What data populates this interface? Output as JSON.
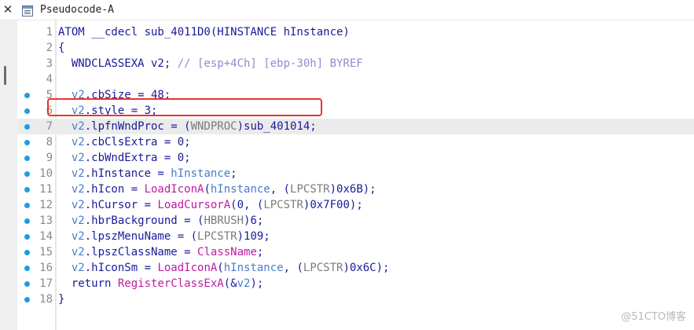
{
  "tab": {
    "close_glyph": "✕",
    "title": "Pseudocode-A",
    "icon": "pseudocode-window-icon"
  },
  "colors": {
    "breakpoint": "#1e9be9",
    "highlight_box": "#e6362d",
    "current_line": "#ebebeb",
    "keyword": "#1a1a99",
    "variable": "#4a7acb",
    "global": "#c01aa3",
    "comment": "#8d8dcc",
    "type_cast": "#7b7b7b"
  },
  "code_lines": [
    {
      "num": "1",
      "bp": false,
      "current": false,
      "tokens": [
        {
          "t": "ATOM __cdecl sub_4011D0(HINSTANCE hInstance)",
          "c": "n"
        }
      ]
    },
    {
      "num": "2",
      "bp": false,
      "current": false,
      "tokens": [
        {
          "t": "{",
          "c": "n"
        }
      ]
    },
    {
      "num": "3",
      "bp": false,
      "current": false,
      "tokens": [
        {
          "t": "  WNDCLASSEXA v2; ",
          "c": "n"
        },
        {
          "t": "// [esp+4Ch] [ebp-30h] BYREF",
          "c": "c"
        }
      ]
    },
    {
      "num": "4",
      "bp": false,
      "current": false,
      "tokens": []
    },
    {
      "num": "5",
      "bp": true,
      "current": false,
      "tokens": [
        {
          "t": "  ",
          "c": "n"
        },
        {
          "t": "v2",
          "c": "v"
        },
        {
          "t": ".cbSize = 48;",
          "c": "n"
        }
      ]
    },
    {
      "num": "6",
      "bp": true,
      "current": false,
      "tokens": [
        {
          "t": "  ",
          "c": "n"
        },
        {
          "t": "v2",
          "c": "v"
        },
        {
          "t": ".style = 3;",
          "c": "n"
        }
      ]
    },
    {
      "num": "7",
      "bp": true,
      "current": true,
      "tokens": [
        {
          "t": "  ",
          "c": "n"
        },
        {
          "t": "v2",
          "c": "v"
        },
        {
          "t": ".lpfnWndProc = (",
          "c": "n"
        },
        {
          "t": "WNDPROC",
          "c": "t"
        },
        {
          "t": ")sub_401014;",
          "c": "n"
        }
      ]
    },
    {
      "num": "8",
      "bp": true,
      "current": false,
      "tokens": [
        {
          "t": "  ",
          "c": "n"
        },
        {
          "t": "v2",
          "c": "v"
        },
        {
          "t": ".cbClsExtra = 0;",
          "c": "n"
        }
      ]
    },
    {
      "num": "9",
      "bp": true,
      "current": false,
      "tokens": [
        {
          "t": "  ",
          "c": "n"
        },
        {
          "t": "v2",
          "c": "v"
        },
        {
          "t": ".cbWndExtra = 0;",
          "c": "n"
        }
      ]
    },
    {
      "num": "10",
      "bp": true,
      "current": false,
      "tokens": [
        {
          "t": "  ",
          "c": "n"
        },
        {
          "t": "v2",
          "c": "v"
        },
        {
          "t": ".hInstance = ",
          "c": "n"
        },
        {
          "t": "hInstance",
          "c": "v"
        },
        {
          "t": ";",
          "c": "n"
        }
      ]
    },
    {
      "num": "11",
      "bp": true,
      "current": false,
      "tokens": [
        {
          "t": "  ",
          "c": "n"
        },
        {
          "t": "v2",
          "c": "v"
        },
        {
          "t": ".hIcon = ",
          "c": "n"
        },
        {
          "t": "LoadIconA",
          "c": "g"
        },
        {
          "t": "(",
          "c": "n"
        },
        {
          "t": "hInstance",
          "c": "v"
        },
        {
          "t": ", (",
          "c": "n"
        },
        {
          "t": "LPCSTR",
          "c": "t"
        },
        {
          "t": ")0x6B);",
          "c": "n"
        }
      ]
    },
    {
      "num": "12",
      "bp": true,
      "current": false,
      "tokens": [
        {
          "t": "  ",
          "c": "n"
        },
        {
          "t": "v2",
          "c": "v"
        },
        {
          "t": ".hCursor = ",
          "c": "n"
        },
        {
          "t": "LoadCursorA",
          "c": "g"
        },
        {
          "t": "(0, (",
          "c": "n"
        },
        {
          "t": "LPCSTR",
          "c": "t"
        },
        {
          "t": ")0x7F00);",
          "c": "n"
        }
      ]
    },
    {
      "num": "13",
      "bp": true,
      "current": false,
      "tokens": [
        {
          "t": "  ",
          "c": "n"
        },
        {
          "t": "v2",
          "c": "v"
        },
        {
          "t": ".hbrBackground = (",
          "c": "n"
        },
        {
          "t": "HBRUSH",
          "c": "t"
        },
        {
          "t": ")6;",
          "c": "n"
        }
      ]
    },
    {
      "num": "14",
      "bp": true,
      "current": false,
      "tokens": [
        {
          "t": "  ",
          "c": "n"
        },
        {
          "t": "v2",
          "c": "v"
        },
        {
          "t": ".lpszMenuName = (",
          "c": "n"
        },
        {
          "t": "LPCSTR",
          "c": "t"
        },
        {
          "t": ")109;",
          "c": "n"
        }
      ]
    },
    {
      "num": "15",
      "bp": true,
      "current": false,
      "tokens": [
        {
          "t": "  ",
          "c": "n"
        },
        {
          "t": "v2",
          "c": "v"
        },
        {
          "t": ".lpszClassName = ",
          "c": "n"
        },
        {
          "t": "ClassName",
          "c": "g"
        },
        {
          "t": ";",
          "c": "n"
        }
      ]
    },
    {
      "num": "16",
      "bp": true,
      "current": false,
      "tokens": [
        {
          "t": "  ",
          "c": "n"
        },
        {
          "t": "v2",
          "c": "v"
        },
        {
          "t": ".hIconSm = ",
          "c": "n"
        },
        {
          "t": "LoadIconA",
          "c": "g"
        },
        {
          "t": "(",
          "c": "n"
        },
        {
          "t": "hInstance",
          "c": "v"
        },
        {
          "t": ", (",
          "c": "n"
        },
        {
          "t": "LPCSTR",
          "c": "t"
        },
        {
          "t": ")0x6C);",
          "c": "n"
        }
      ]
    },
    {
      "num": "17",
      "bp": true,
      "current": false,
      "tokens": [
        {
          "t": "  return ",
          "c": "n"
        },
        {
          "t": "RegisterClassExA",
          "c": "g"
        },
        {
          "t": "(&",
          "c": "n"
        },
        {
          "t": "v2",
          "c": "v"
        },
        {
          "t": ");",
          "c": "n"
        }
      ]
    },
    {
      "num": "18",
      "bp": true,
      "current": false,
      "tokens": [
        {
          "t": "}",
          "c": "n"
        }
      ]
    }
  ],
  "watermark": "@51CTO博客"
}
